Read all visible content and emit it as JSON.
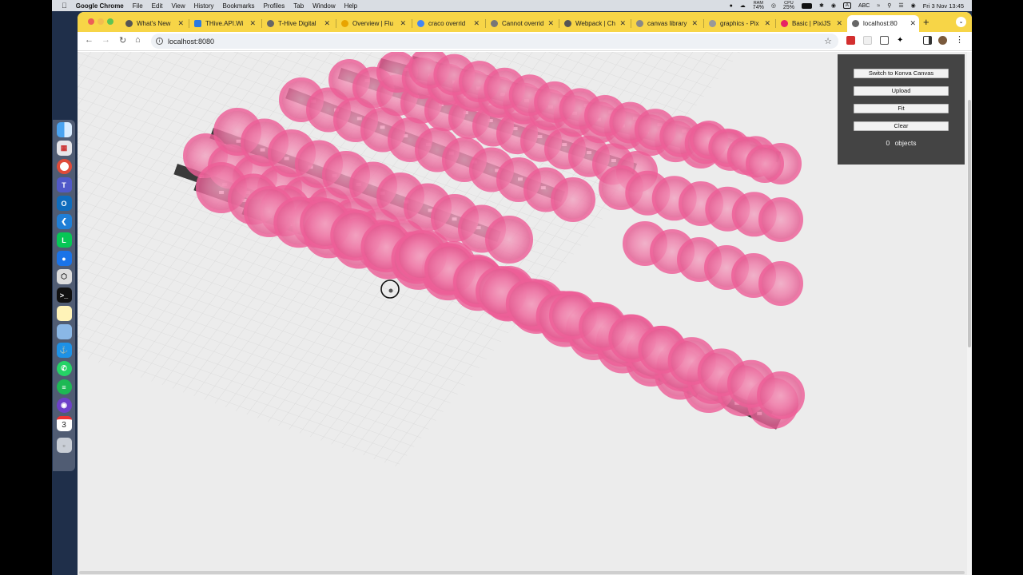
{
  "menubar": {
    "app_name": "Google Chrome",
    "items": [
      "File",
      "Edit",
      "View",
      "History",
      "Bookmarks",
      "Profiles",
      "Tab",
      "Window",
      "Help"
    ],
    "ram_label": "RAM",
    "ram_value": "74%",
    "cpu_label": "CPU",
    "cpu_value": "25%",
    "input_label": "ABC",
    "datetime": "Fri 3 Nov  13:45"
  },
  "dock": {
    "calendar_day": "3",
    "apps": [
      "finder-icon",
      "launchpad-icon",
      "chrome-icon",
      "teams-icon",
      "outlook-icon",
      "vscode-icon",
      "line-icon",
      "maps-icon",
      "unity-icon",
      "terminal-icon",
      "notes-icon",
      "preview-icon",
      "docker-icon",
      "whatsapp-icon",
      "spotify-icon",
      "github-desktop-icon",
      "calendar-icon",
      "trash-icon"
    ]
  },
  "tabs": [
    {
      "title": "What's New",
      "fav": "#555"
    },
    {
      "title": "THive.API.Wi",
      "fav": "#2a7ae2"
    },
    {
      "title": "T-Hive Digital",
      "fav": "#666"
    },
    {
      "title": "Overview | Flu",
      "fav": "#e8a400"
    },
    {
      "title": "craco overrid",
      "fav": "#4285f4"
    },
    {
      "title": "Cannot overrid",
      "fav": "#777"
    },
    {
      "title": "Webpack | Ch",
      "fav": "#555"
    },
    {
      "title": "canvas library",
      "fav": "#888"
    },
    {
      "title": "graphics - Pix",
      "fav": "#999"
    },
    {
      "title": "Basic | PixiJS",
      "fav": "#e72264"
    },
    {
      "title": "localhost:80",
      "fav": "#666"
    }
  ],
  "new_tab_label": "+",
  "address": {
    "url": "localhost:8080"
  },
  "panel": {
    "switch_label": "Switch to Konva Canvas",
    "upload_label": "Upload",
    "fit_label": "Fit",
    "clear_label": "Clear",
    "objects_count": "0",
    "objects_label": "objects"
  },
  "colors": {
    "tab_strip": "#f7d547",
    "canvas_bg": "#ececec",
    "panel_bg": "#444444",
    "circle_fill": "#ee5f98",
    "tile": "#3a3a3a"
  }
}
